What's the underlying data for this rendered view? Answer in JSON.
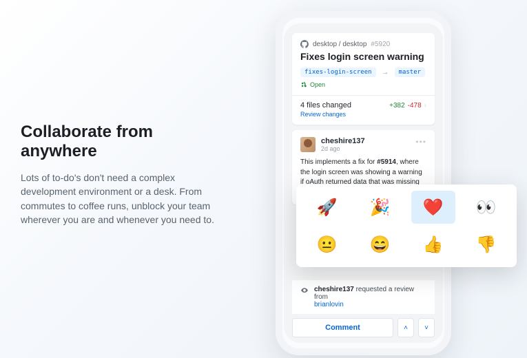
{
  "hero": {
    "title": "Collaborate from anywhere",
    "description": "Lots of to-do's don't need a complex development environment or a desk. From commutes to coffee runs, unblock your team wherever you are and whenever you need to."
  },
  "pr": {
    "repo_path": "desktop / desktop",
    "number": "#5920",
    "title": "Fixes login screen warning",
    "branch_from": "fixes-login-screen",
    "branch_to": "master",
    "state": "Open",
    "files_changed": "4 files changed",
    "additions": "+382",
    "deletions": "-478",
    "review_changes": "Review changes"
  },
  "comment": {
    "user": "cheshire137",
    "time": "2d ago",
    "body_prefix": "This implements a fix for ",
    "body_issue": "#5914",
    "body_suffix": ", where the login screen was showing a warning if oAuth returned data that was missing fields like \"description\""
  },
  "event": {
    "actor": "cheshire137",
    "text": " requested a review from ",
    "reviewer": "brianlovin"
  },
  "actions": {
    "comment": "Comment"
  },
  "reactions": {
    "r1": "🚀",
    "r2": "🎉",
    "r3": "❤️",
    "r4": "👀",
    "r5": "😐",
    "r6": "😄",
    "r7": "👍",
    "r8": "👎"
  }
}
